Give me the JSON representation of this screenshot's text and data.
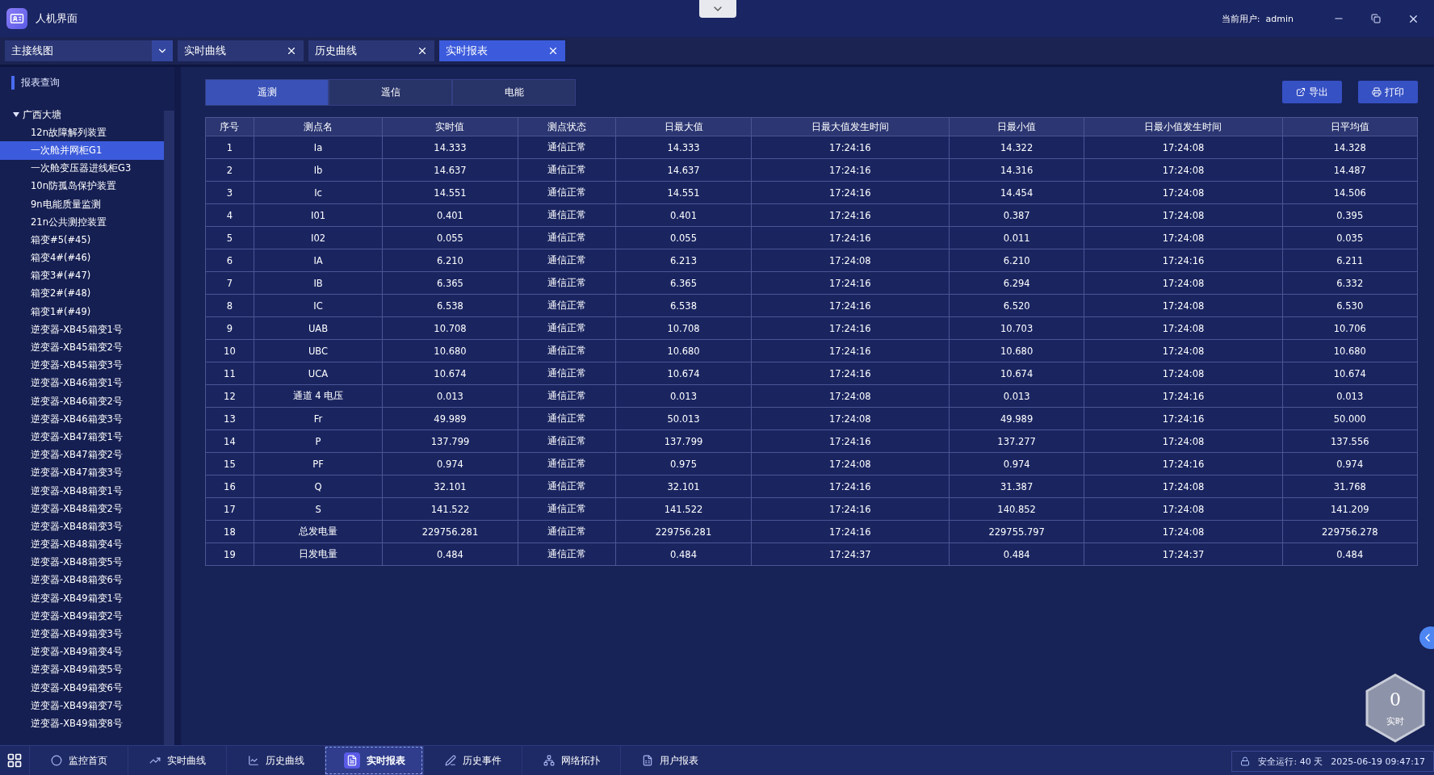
{
  "window": {
    "title": "人机界面",
    "user_label": "当前用户:",
    "user": "admin"
  },
  "tabs": [
    {
      "label": "主接线图",
      "kind": "dropdown",
      "selected": false
    },
    {
      "label": "实时曲线",
      "kind": "closable",
      "selected": false
    },
    {
      "label": "历史曲线",
      "kind": "closable",
      "selected": false
    },
    {
      "label": "实时报表",
      "kind": "closable",
      "selected": true
    }
  ],
  "sidebar": {
    "title": "报表查询",
    "tree": [
      {
        "label": "广西大塘",
        "expanded": true,
        "selected": false,
        "children": [
          {
            "label": "12n故障解列装置",
            "selected": false
          },
          {
            "label": "一次舱并网柜G1",
            "selected": true
          },
          {
            "label": "一次舱变压器进线柜G3",
            "selected": false
          },
          {
            "label": "10n防孤岛保护装置",
            "selected": false
          },
          {
            "label": "9n电能质量监测",
            "selected": false
          },
          {
            "label": "21n公共测控装置",
            "selected": false
          },
          {
            "label": "箱变#5(#45)",
            "selected": false
          },
          {
            "label": "箱变4#(#46)",
            "selected": false
          },
          {
            "label": "箱变3#(#47)",
            "selected": false
          },
          {
            "label": "箱变2#(#48)",
            "selected": false
          },
          {
            "label": "箱变1#(#49)",
            "selected": false
          },
          {
            "label": "逆变器-XB45箱变1号",
            "selected": false
          },
          {
            "label": "逆变器-XB45箱变2号",
            "selected": false
          },
          {
            "label": "逆变器-XB45箱变3号",
            "selected": false
          },
          {
            "label": "逆变器-XB46箱变1号",
            "selected": false
          },
          {
            "label": "逆变器-XB46箱变2号",
            "selected": false
          },
          {
            "label": "逆变器-XB46箱变3号",
            "selected": false
          },
          {
            "label": "逆变器-XB47箱变1号",
            "selected": false
          },
          {
            "label": "逆变器-XB47箱变2号",
            "selected": false
          },
          {
            "label": "逆变器-XB47箱变3号",
            "selected": false
          },
          {
            "label": "逆变器-XB48箱变1号",
            "selected": false
          },
          {
            "label": "逆变器-XB48箱变2号",
            "selected": false
          },
          {
            "label": "逆变器-XB48箱变3号",
            "selected": false
          },
          {
            "label": "逆变器-XB48箱变4号",
            "selected": false
          },
          {
            "label": "逆变器-XB48箱变5号",
            "selected": false
          },
          {
            "label": "逆变器-XB48箱变6号",
            "selected": false
          },
          {
            "label": "逆变器-XB49箱变1号",
            "selected": false
          },
          {
            "label": "逆变器-XB49箱变2号",
            "selected": false
          },
          {
            "label": "逆变器-XB49箱变3号",
            "selected": false
          },
          {
            "label": "逆变器-XB49箱变4号",
            "selected": false
          },
          {
            "label": "逆变器-XB49箱变5号",
            "selected": false
          },
          {
            "label": "逆变器-XB49箱变6号",
            "selected": false
          },
          {
            "label": "逆变器-XB49箱变7号",
            "selected": false
          },
          {
            "label": "逆变器-XB49箱变8号",
            "selected": false
          }
        ]
      }
    ]
  },
  "subtabs": [
    {
      "label": "遥测",
      "selected": true
    },
    {
      "label": "遥信",
      "selected": false
    },
    {
      "label": "电能",
      "selected": false
    }
  ],
  "actions": [
    {
      "label": "导出",
      "kind": "export"
    },
    {
      "label": "打印",
      "kind": "print"
    }
  ],
  "table": {
    "columns": [
      "序号",
      "测点名",
      "实时值",
      "测点状态",
      "日最大值",
      "日最大值发生时间",
      "日最小值",
      "日最小值发生时间",
      "日平均值"
    ],
    "rows": [
      [
        "1",
        "Ia",
        "14.333",
        "通信正常",
        "14.333",
        "17:24:16",
        "14.322",
        "17:24:08",
        "14.328"
      ],
      [
        "2",
        "Ib",
        "14.637",
        "通信正常",
        "14.637",
        "17:24:16",
        "14.316",
        "17:24:08",
        "14.487"
      ],
      [
        "3",
        "Ic",
        "14.551",
        "通信正常",
        "14.551",
        "17:24:16",
        "14.454",
        "17:24:08",
        "14.506"
      ],
      [
        "4",
        "I01",
        "0.401",
        "通信正常",
        "0.401",
        "17:24:16",
        "0.387",
        "17:24:08",
        "0.395"
      ],
      [
        "5",
        "I02",
        "0.055",
        "通信正常",
        "0.055",
        "17:24:16",
        "0.011",
        "17:24:08",
        "0.035"
      ],
      [
        "6",
        "IA",
        "6.210",
        "通信正常",
        "6.213",
        "17:24:08",
        "6.210",
        "17:24:16",
        "6.211"
      ],
      [
        "7",
        "IB",
        "6.365",
        "通信正常",
        "6.365",
        "17:24:16",
        "6.294",
        "17:24:08",
        "6.332"
      ],
      [
        "8",
        "IC",
        "6.538",
        "通信正常",
        "6.538",
        "17:24:16",
        "6.520",
        "17:24:08",
        "6.530"
      ],
      [
        "9",
        "UAB",
        "10.708",
        "通信正常",
        "10.708",
        "17:24:16",
        "10.703",
        "17:24:08",
        "10.706"
      ],
      [
        "10",
        "UBC",
        "10.680",
        "通信正常",
        "10.680",
        "17:24:16",
        "10.680",
        "17:24:08",
        "10.680"
      ],
      [
        "11",
        "UCA",
        "10.674",
        "通信正常",
        "10.674",
        "17:24:16",
        "10.674",
        "17:24:08",
        "10.674"
      ],
      [
        "12",
        "通道 4 电压",
        "0.013",
        "通信正常",
        "0.013",
        "17:24:08",
        "0.013",
        "17:24:16",
        "0.013"
      ],
      [
        "13",
        "Fr",
        "49.989",
        "通信正常",
        "50.013",
        "17:24:08",
        "49.989",
        "17:24:16",
        "50.000"
      ],
      [
        "14",
        "P",
        "137.799",
        "通信正常",
        "137.799",
        "17:24:16",
        "137.277",
        "17:24:08",
        "137.556"
      ],
      [
        "15",
        "PF",
        "0.974",
        "通信正常",
        "0.975",
        "17:24:08",
        "0.974",
        "17:24:16",
        "0.974"
      ],
      [
        "16",
        "Q",
        "32.101",
        "通信正常",
        "32.101",
        "17:24:16",
        "31.387",
        "17:24:08",
        "31.768"
      ],
      [
        "17",
        "S",
        "141.522",
        "通信正常",
        "141.522",
        "17:24:16",
        "140.852",
        "17:24:08",
        "141.209"
      ],
      [
        "18",
        "总发电量",
        "229756.281",
        "通信正常",
        "229756.281",
        "17:24:16",
        "229755.797",
        "17:24:08",
        "229756.278"
      ],
      [
        "19",
        "日发电量",
        "0.484",
        "通信正常",
        "0.484",
        "17:24:37",
        "0.484",
        "17:24:37",
        "0.484"
      ]
    ]
  },
  "realtime_badge": {
    "count": "0",
    "label": "实时"
  },
  "taskbar": [
    {
      "label": "监控首页",
      "kind": "home",
      "selected": false
    },
    {
      "label": "实时曲线",
      "kind": "realtime",
      "selected": false
    },
    {
      "label": "历史曲线",
      "kind": "history",
      "selected": false
    },
    {
      "label": "实时报表",
      "kind": "report",
      "selected": true
    },
    {
      "label": "历史事件",
      "kind": "event",
      "selected": false
    },
    {
      "label": "网络拓扑",
      "kind": "network",
      "selected": false
    },
    {
      "label": "用户报表",
      "kind": "userreport",
      "selected": false
    }
  ],
  "status_bar": {
    "safe_run": "安全运行: 40 天",
    "datetime": "2025-06-19 09:47:17"
  }
}
